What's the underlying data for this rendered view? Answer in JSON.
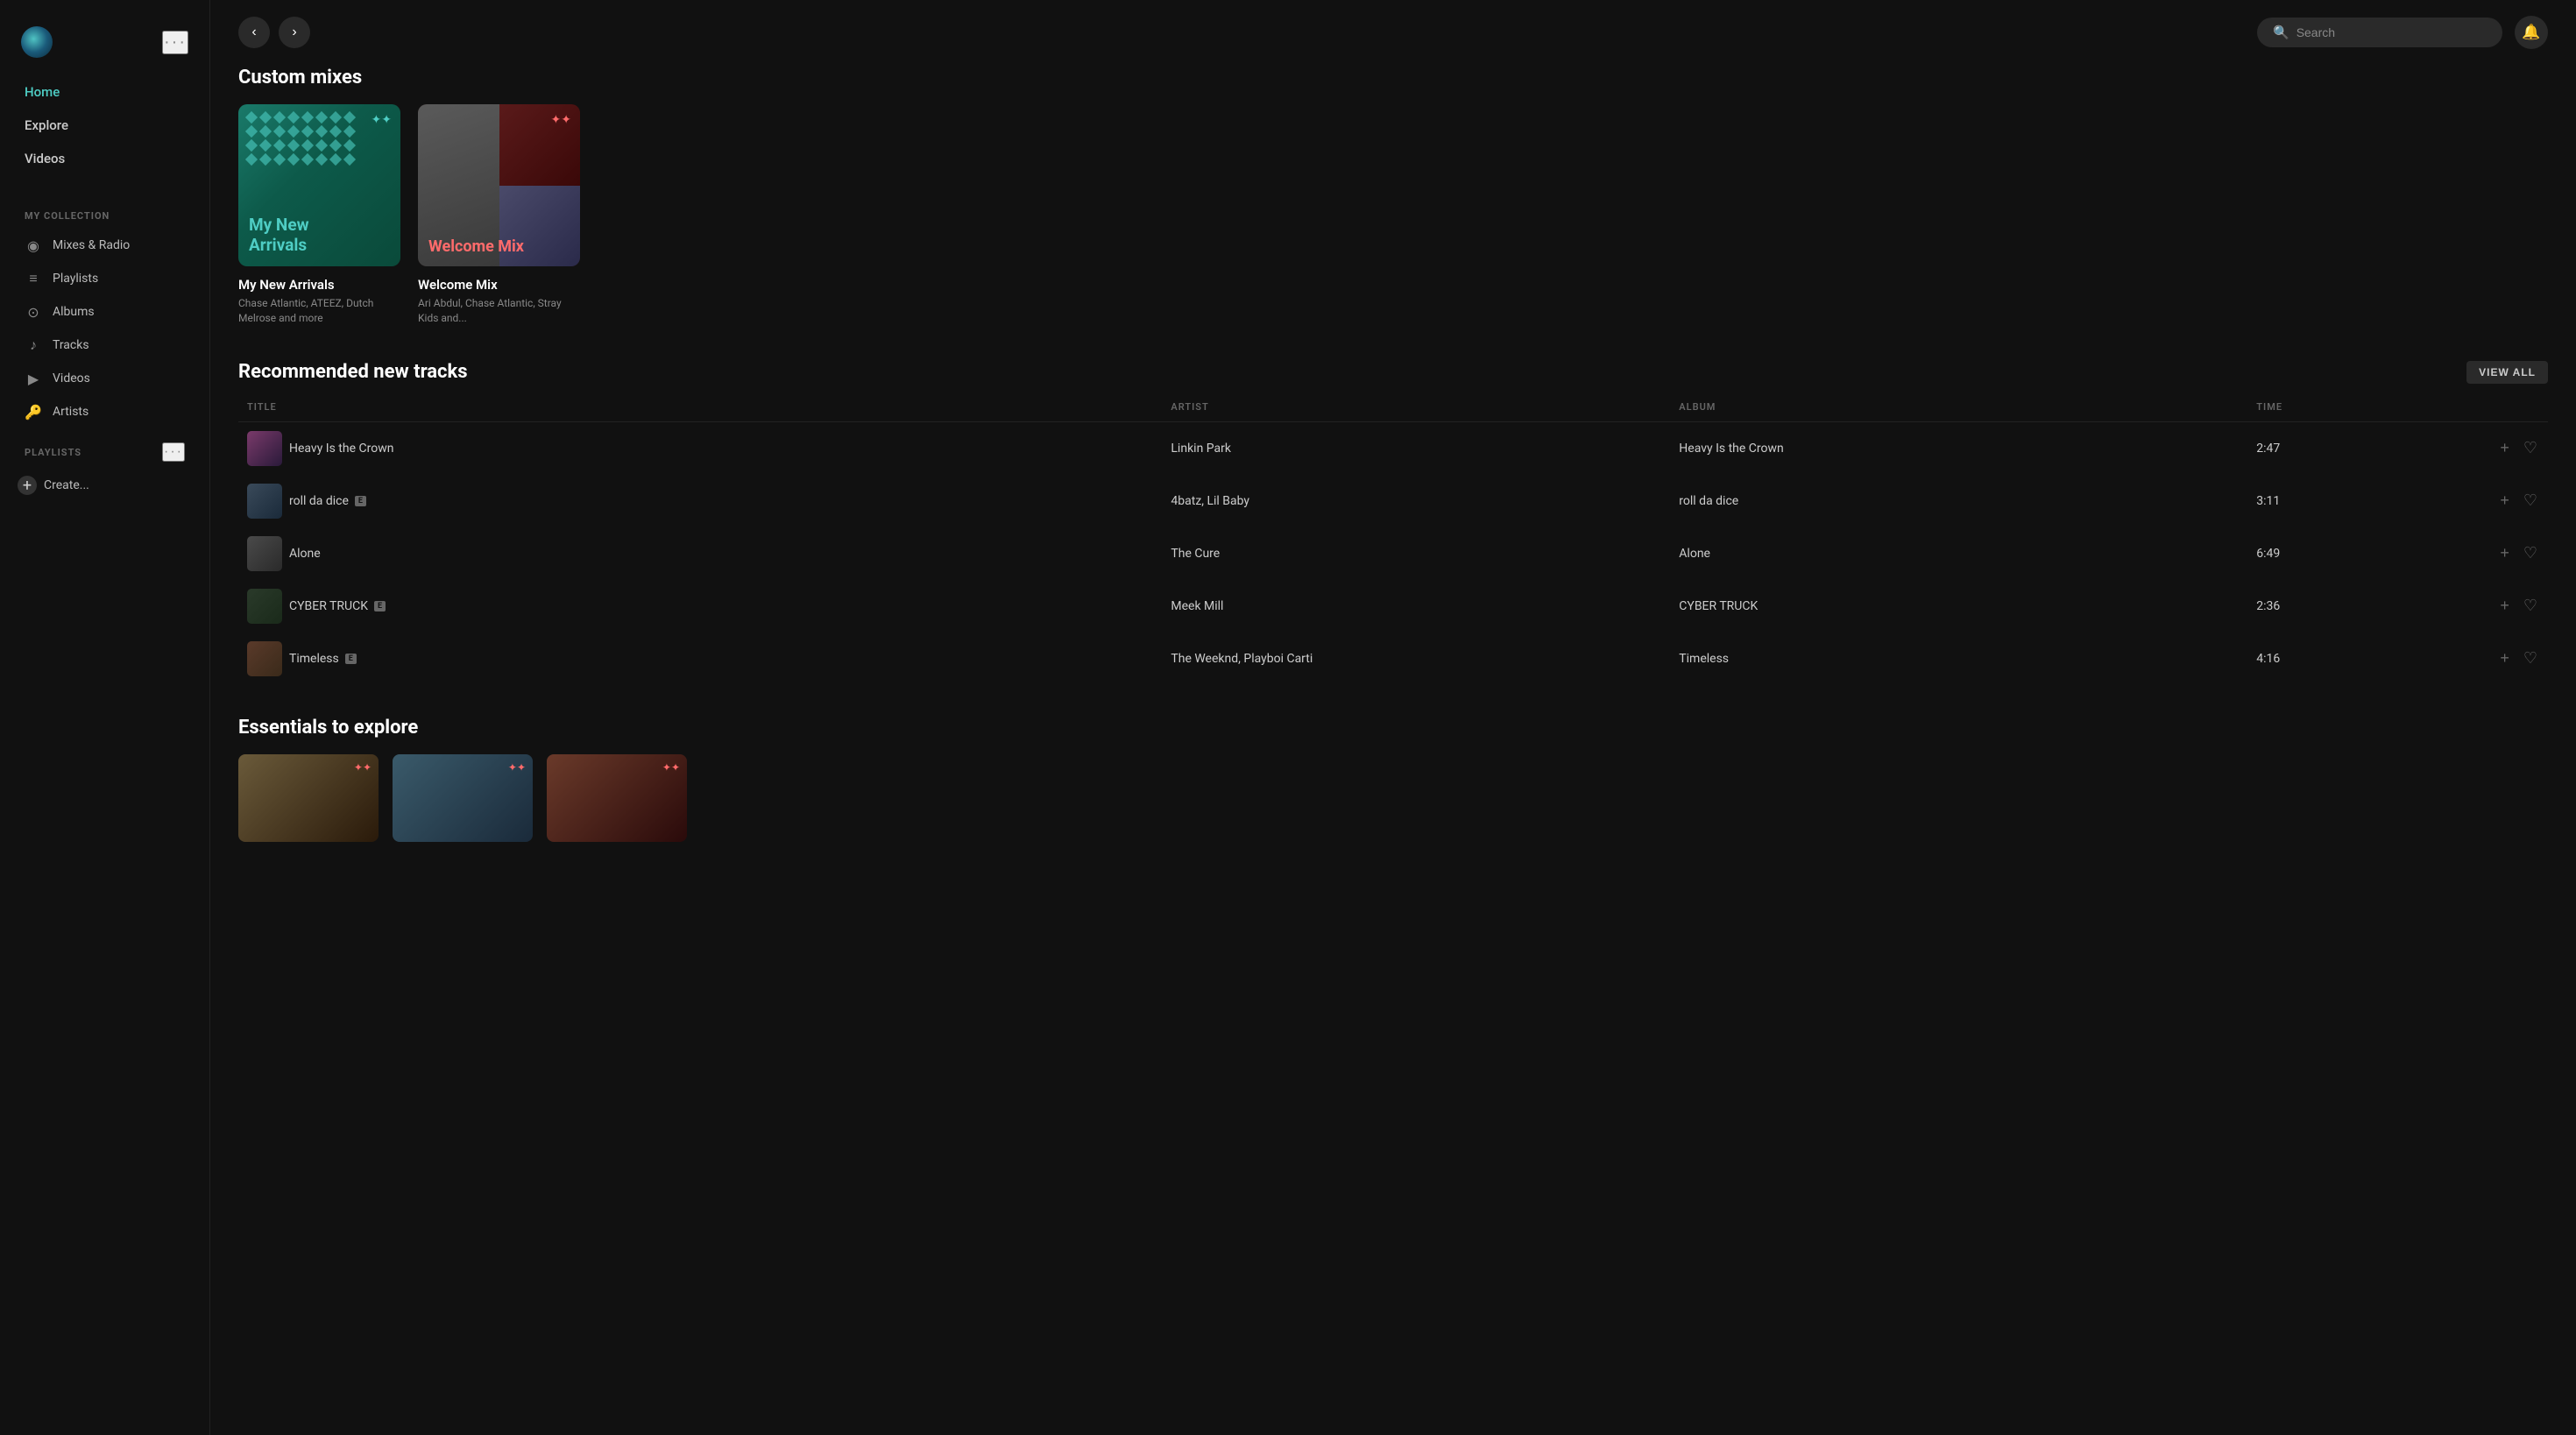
{
  "app": {
    "logo_alt": "Tidal Logo"
  },
  "sidebar": {
    "nav": [
      {
        "id": "home",
        "label": "Home",
        "active": true
      },
      {
        "id": "explore",
        "label": "Explore",
        "active": false
      },
      {
        "id": "videos",
        "label": "Videos",
        "active": false
      }
    ],
    "collection_label": "My Collection",
    "collection_items": [
      {
        "id": "mixes-radio",
        "label": "Mixes & Radio",
        "icon": "📻"
      },
      {
        "id": "playlists",
        "label": "Playlists",
        "icon": "≡"
      },
      {
        "id": "albums",
        "label": "Albums",
        "icon": "⊙"
      },
      {
        "id": "tracks",
        "label": "Tracks",
        "icon": "♪"
      },
      {
        "id": "videos",
        "label": "Videos",
        "icon": "▶"
      },
      {
        "id": "artists",
        "label": "Artists",
        "icon": "🔑"
      }
    ],
    "playlists_label": "Playlists",
    "create_label": "Create..."
  },
  "topbar": {
    "search_placeholder": "Search",
    "back_btn": "‹",
    "forward_btn": "›"
  },
  "custom_mixes": {
    "section_title": "Custom mixes",
    "items": [
      {
        "id": "my-new-arrivals",
        "title": "My New Arrivals",
        "subtitle": "Chase Atlantic, ATEEZ, Dutch Melrose and more",
        "label_overlay": "My New Arrivals",
        "type": "green"
      },
      {
        "id": "welcome-mix",
        "title": "Welcome Mix",
        "subtitle": "Ari Abdul, Chase Atlantic, Stray Kids and...",
        "label_overlay": "Welcome Mix",
        "type": "collage"
      }
    ]
  },
  "recommended_tracks": {
    "section_title": "Recommended new tracks",
    "view_all_label": "VIEW ALL",
    "columns": {
      "title": "Title",
      "artist": "Artist",
      "album": "Album",
      "time": "Time"
    },
    "items": [
      {
        "id": "track-1",
        "title": "Heavy Is the Crown",
        "explicit": false,
        "artist": "Linkin Park",
        "album": "Heavy Is the Crown",
        "time": "2:47",
        "thumb_class": "track-thumb-1"
      },
      {
        "id": "track-2",
        "title": "roll da dice",
        "explicit": true,
        "artist": "4batz, Lil Baby",
        "album": "roll da dice",
        "time": "3:11",
        "thumb_class": "track-thumb-2"
      },
      {
        "id": "track-3",
        "title": "Alone",
        "explicit": false,
        "artist": "The Cure",
        "album": "Alone",
        "time": "6:49",
        "thumb_class": "track-thumb-3"
      },
      {
        "id": "track-4",
        "title": "CYBER TRUCK",
        "explicit": true,
        "artist": "Meek Mill",
        "album": "CYBER TRUCK",
        "time": "2:36",
        "thumb_class": "track-thumb-4"
      },
      {
        "id": "track-5",
        "title": "Timeless",
        "explicit": true,
        "artist": "The Weeknd, Playboi Carti",
        "album": "Timeless",
        "time": "4:16",
        "thumb_class": "track-thumb-5"
      }
    ]
  },
  "essentials": {
    "section_title": "Essentials to explore",
    "items": [
      {
        "id": "essential-1",
        "thumb_class": "essential-thumb-1"
      },
      {
        "id": "essential-2",
        "thumb_class": "essential-thumb-2"
      },
      {
        "id": "essential-3",
        "thumb_class": "essential-thumb-3"
      }
    ]
  }
}
